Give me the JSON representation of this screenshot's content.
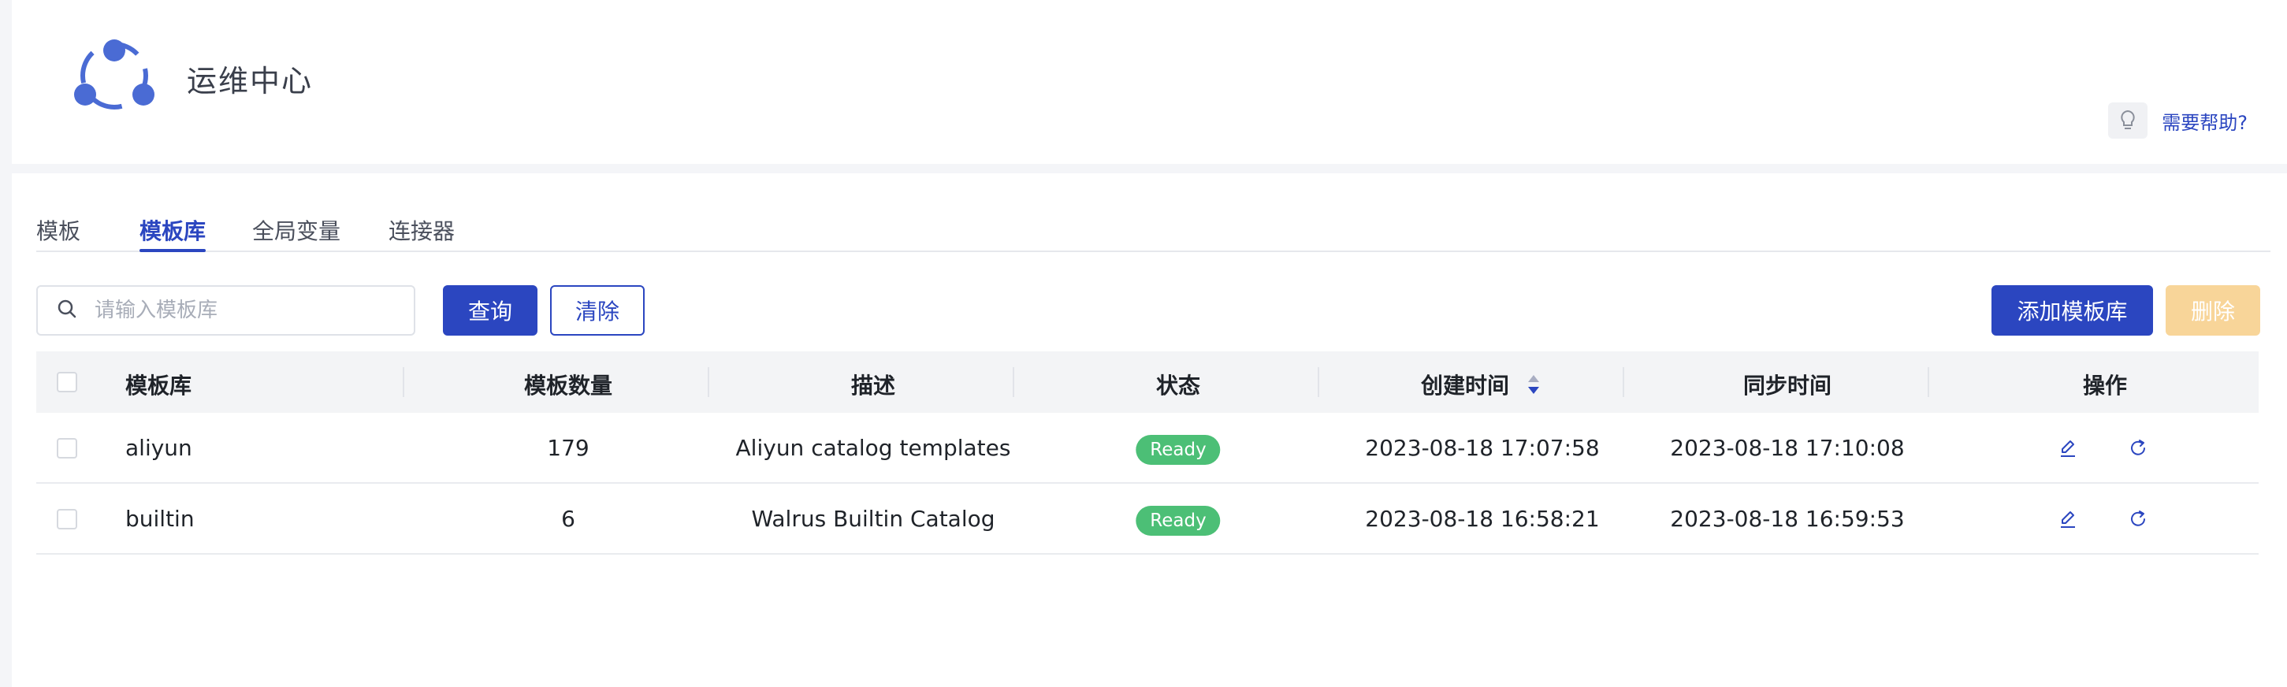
{
  "app": {
    "title": "运维中心",
    "help_label": "需要帮助?"
  },
  "tabs": [
    {
      "label": "模板",
      "active": false
    },
    {
      "label": "模板库",
      "active": true
    },
    {
      "label": "全局变量",
      "active": false
    },
    {
      "label": "连接器",
      "active": false
    }
  ],
  "toolbar": {
    "search_placeholder": "请输入模板库",
    "search_value": "",
    "query_label": "查询",
    "clear_label": "清除",
    "add_label": "添加模板库",
    "delete_label": "删除"
  },
  "table": {
    "headers": {
      "name": "模板库",
      "count": "模板数量",
      "description": "描述",
      "status": "状态",
      "created": "创建时间",
      "synced": "同步时间",
      "actions": "操作"
    },
    "rows": [
      {
        "name": "aliyun",
        "count": "179",
        "description": "Aliyun catalog templates",
        "status": "Ready",
        "created": "2023-08-18 17:07:58",
        "synced": "2023-08-18 17:10:08"
      },
      {
        "name": "builtin",
        "count": "6",
        "description": "Walrus Builtin Catalog",
        "status": "Ready",
        "created": "2023-08-18 16:58:21",
        "synced": "2023-08-18 16:59:53"
      }
    ]
  },
  "colors": {
    "primary": "#2b46c0",
    "status_ready": "#4cbf76",
    "delete_disabled": "#f8d599",
    "logo": "#4a6bd4"
  },
  "icons": {
    "logo": "three-node-circle-logo",
    "help": "lightbulb-icon",
    "search": "search-icon",
    "sort": "sort-icon",
    "edit": "edit-icon",
    "sync": "refresh-icon"
  }
}
